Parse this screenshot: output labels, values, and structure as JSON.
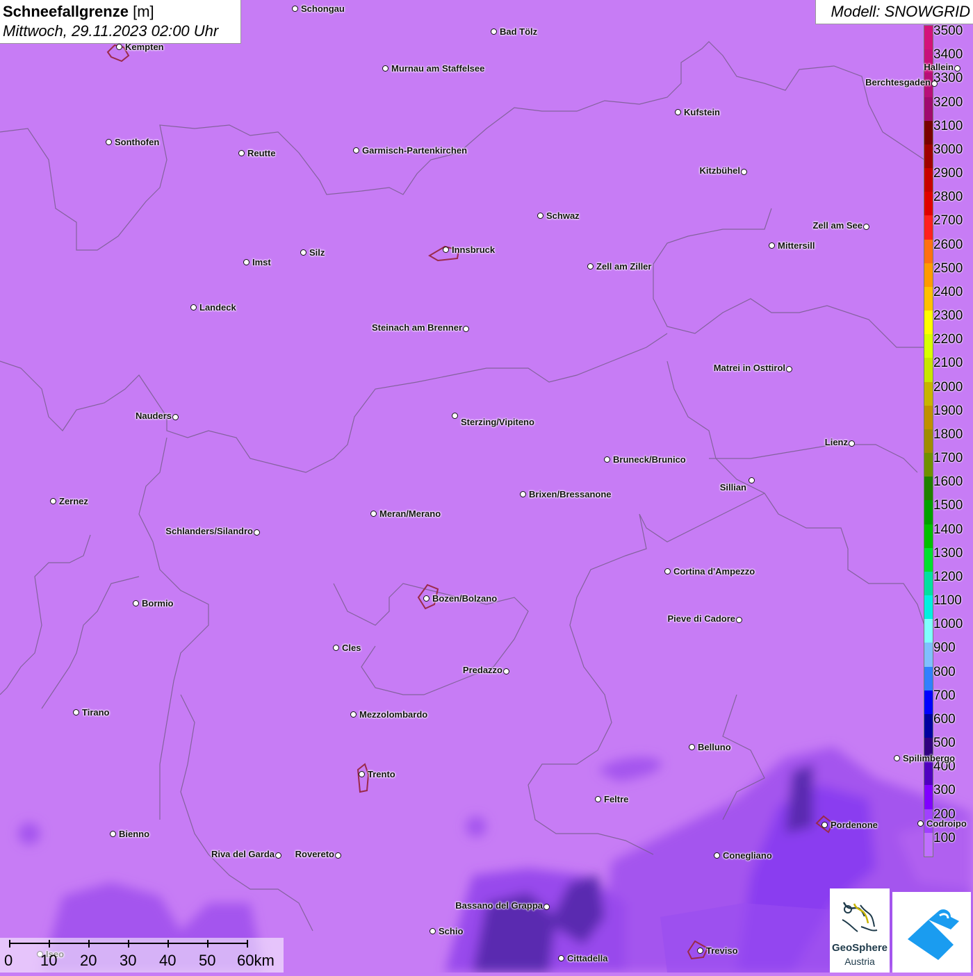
{
  "header": {
    "title_bold": "Schneefallgrenze",
    "title_unit": "[m]",
    "subtitle": "Mittwoch, 29.11.2023 02:00 Uhr",
    "model": "Modell: SNOWGRID"
  },
  "legend": {
    "values": [
      "3500",
      "3400",
      "3300",
      "3200",
      "3100",
      "3000",
      "2900",
      "2800",
      "2700",
      "2600",
      "2500",
      "2400",
      "2300",
      "2200",
      "2100",
      "2000",
      "1900",
      "1800",
      "1700",
      "1600",
      "1500",
      "1400",
      "1300",
      "1200",
      "1100",
      "1000",
      "900",
      "800",
      "700",
      "600",
      "500",
      "400",
      "300",
      "200",
      "100"
    ],
    "colors": [
      "#d4127a",
      "#c8107a",
      "#b80e78",
      "#a00a6e",
      "#7a0000",
      "#a00000",
      "#c80000",
      "#e00000",
      "#ff2020",
      "#ff7010",
      "#ff9a00",
      "#ffc000",
      "#ffff00",
      "#d8ff00",
      "#c8e600",
      "#c8b400",
      "#c09000",
      "#a08c00",
      "#709000",
      "#208000",
      "#00a000",
      "#00c000",
      "#00e030",
      "#00e0a0",
      "#00f0e0",
      "#80ffff",
      "#80c0ff",
      "#3080ff",
      "#0000ff",
      "#0000a0",
      "#300080",
      "#5000c0",
      "#8000ff",
      "#a040ff",
      "#c070ff"
    ]
  },
  "cities": [
    {
      "name": "Schongau"
    },
    {
      "name": "Bad Tölz"
    },
    {
      "name": "Kempten"
    },
    {
      "name": "Murnau am Staffelsee"
    },
    {
      "name": "Hallein"
    },
    {
      "name": "Berchtesgaden"
    },
    {
      "name": "Kufstein"
    },
    {
      "name": "Sonthofen"
    },
    {
      "name": "Reutte"
    },
    {
      "name": "Garmisch-Partenkirchen"
    },
    {
      "name": "Kitzbühel"
    },
    {
      "name": "Schwaz"
    },
    {
      "name": "Zell am See"
    },
    {
      "name": "Innsbruck"
    },
    {
      "name": "Mittersill"
    },
    {
      "name": "Silz"
    },
    {
      "name": "Imst"
    },
    {
      "name": "Zell am Ziller"
    },
    {
      "name": "Landeck"
    },
    {
      "name": "Steinach am Brenner"
    },
    {
      "name": "Matrei in Osttirol"
    },
    {
      "name": "Nauders"
    },
    {
      "name": "Sterzing/Vipiteno"
    },
    {
      "name": "Lienz"
    },
    {
      "name": "Bruneck/Brunico"
    },
    {
      "name": "Sillian"
    },
    {
      "name": "Brixen/Bressanone"
    },
    {
      "name": "Zernez"
    },
    {
      "name": "Meran/Merano"
    },
    {
      "name": "Schlanders/Silandro"
    },
    {
      "name": "Cortina d'Ampezzo"
    },
    {
      "name": "Bozen/Bolzano"
    },
    {
      "name": "Bormio"
    },
    {
      "name": "Pieve di Cadore"
    },
    {
      "name": "Cles"
    },
    {
      "name": "Predazzo"
    },
    {
      "name": "Tirano"
    },
    {
      "name": "Mezzolombardo"
    },
    {
      "name": "Belluno"
    },
    {
      "name": "Spilimbergo"
    },
    {
      "name": "Trento"
    },
    {
      "name": "Feltre"
    },
    {
      "name": "Pordenone"
    },
    {
      "name": "Codroipo"
    },
    {
      "name": "Bienno"
    },
    {
      "name": "Riva del Garda"
    },
    {
      "name": "Rovereto"
    },
    {
      "name": "Conegliano"
    },
    {
      "name": "Bassano del Grappa"
    },
    {
      "name": "Schio"
    },
    {
      "name": "Treviso"
    },
    {
      "name": "Cittadella"
    },
    {
      "name": "Iseo"
    }
  ],
  "scale": {
    "labels": [
      "0",
      "10",
      "20",
      "30",
      "40",
      "50",
      "60km"
    ]
  },
  "logo": {
    "line1": "GeoSphere",
    "line2": "Austria"
  }
}
